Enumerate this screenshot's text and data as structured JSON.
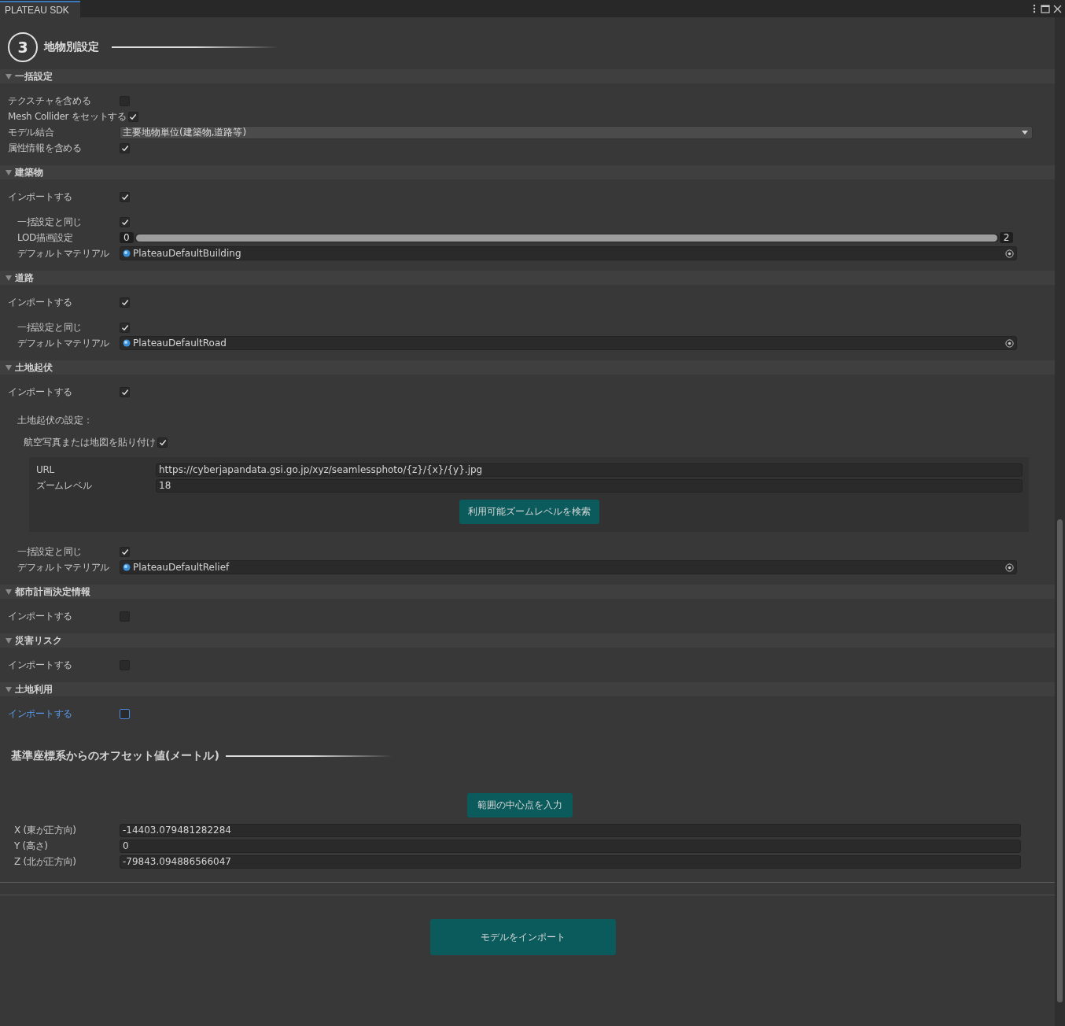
{
  "window": {
    "tab": "PLATEAU SDK"
  },
  "step": {
    "number": "3",
    "title": "地物別設定"
  },
  "sections": [
    {
      "title": "一括設定",
      "expanded": true,
      "rows": [
        {
          "kind": "checkbox",
          "label": "テクスチャを含める",
          "checked": false,
          "focused": false
        },
        {
          "kind": "checkbox",
          "label": "Mesh Collider をセットする",
          "checked": true,
          "focused": false
        },
        {
          "kind": "dropdown",
          "label": "モデル結合",
          "value": "主要地物単位(建築物,道路等)"
        },
        {
          "kind": "checkbox",
          "label": "属性情報を含める",
          "checked": true,
          "focused": false
        }
      ]
    },
    {
      "title": "建築物",
      "expanded": true,
      "rows": [
        {
          "kind": "checkbox",
          "label": "インポートする",
          "checked": true,
          "focused": false
        }
      ],
      "sub_rows": [
        {
          "kind": "checkbox",
          "label": "一括設定と同じ",
          "checked": true,
          "focused": false
        },
        {
          "kind": "range",
          "label": "LOD描画設定",
          "min": "0",
          "max": "2",
          "level": 1
        },
        {
          "kind": "material",
          "label": "デフォルトマテリアル",
          "value": "PlateauDefaultBuilding"
        }
      ]
    },
    {
      "title": "道路",
      "expanded": true,
      "rows": [
        {
          "kind": "checkbox",
          "label": "インポートする",
          "checked": true,
          "focused": false
        }
      ],
      "sub_rows": [
        {
          "kind": "checkbox",
          "label": "一括設定と同じ",
          "checked": true,
          "focused": false
        },
        {
          "kind": "material",
          "label": "デフォルトマテリアル",
          "value": "PlateauDefaultRoad"
        }
      ]
    },
    {
      "title": "土地起伏",
      "expanded": true,
      "rows": [
        {
          "kind": "checkbox",
          "label": "インポートする",
          "checked": true,
          "focused": false
        }
      ],
      "sub_rows": [
        {
          "kind": "label",
          "label": "土地起伏の設定："
        },
        {
          "kind": "inline_checkbox",
          "label": "航空写真または地図を貼り付け",
          "checked": true
        },
        {
          "kind": "panel",
          "fields": [
            {
              "label": "URL",
              "value": "https://cyberjapandata.gsi.go.jp/xyz/seamlessphoto/{z}/{x}/{y}.jpg"
            },
            {
              "label": "ズームレベル",
              "value": "18"
            }
          ],
          "button": "利用可能ズームレベルを検索"
        },
        {
          "kind": "checkbox",
          "label": "一括設定と同じ",
          "checked": true,
          "focused": false
        },
        {
          "kind": "material",
          "label": "デフォルトマテリアル",
          "value": "PlateauDefaultRelief"
        }
      ]
    },
    {
      "title": "都市計画決定情報",
      "expanded": true,
      "rows": [
        {
          "kind": "checkbox",
          "label": "インポートする",
          "checked": false,
          "focused": false
        }
      ]
    },
    {
      "title": "災害リスク",
      "expanded": true,
      "rows": [
        {
          "kind": "checkbox",
          "label": "インポートする",
          "checked": false,
          "focused": false
        }
      ]
    },
    {
      "title": "土地利用",
      "expanded": true,
      "rows": [
        {
          "kind": "checkbox",
          "label": "インポートする",
          "checked": false,
          "focused": true
        }
      ]
    }
  ],
  "offset": {
    "title": "基準座標系からのオフセット値(メートル)",
    "button": "範囲の中心点を入力",
    "fields": [
      {
        "label": "X (東が正方向)",
        "value": "-14403.079481282284"
      },
      {
        "label": "Y (高さ)",
        "value": "0"
      },
      {
        "label": "Z (北が正方向)",
        "value": "-79843.094886566047"
      }
    ]
  },
  "import_button": "モデルをインポート"
}
